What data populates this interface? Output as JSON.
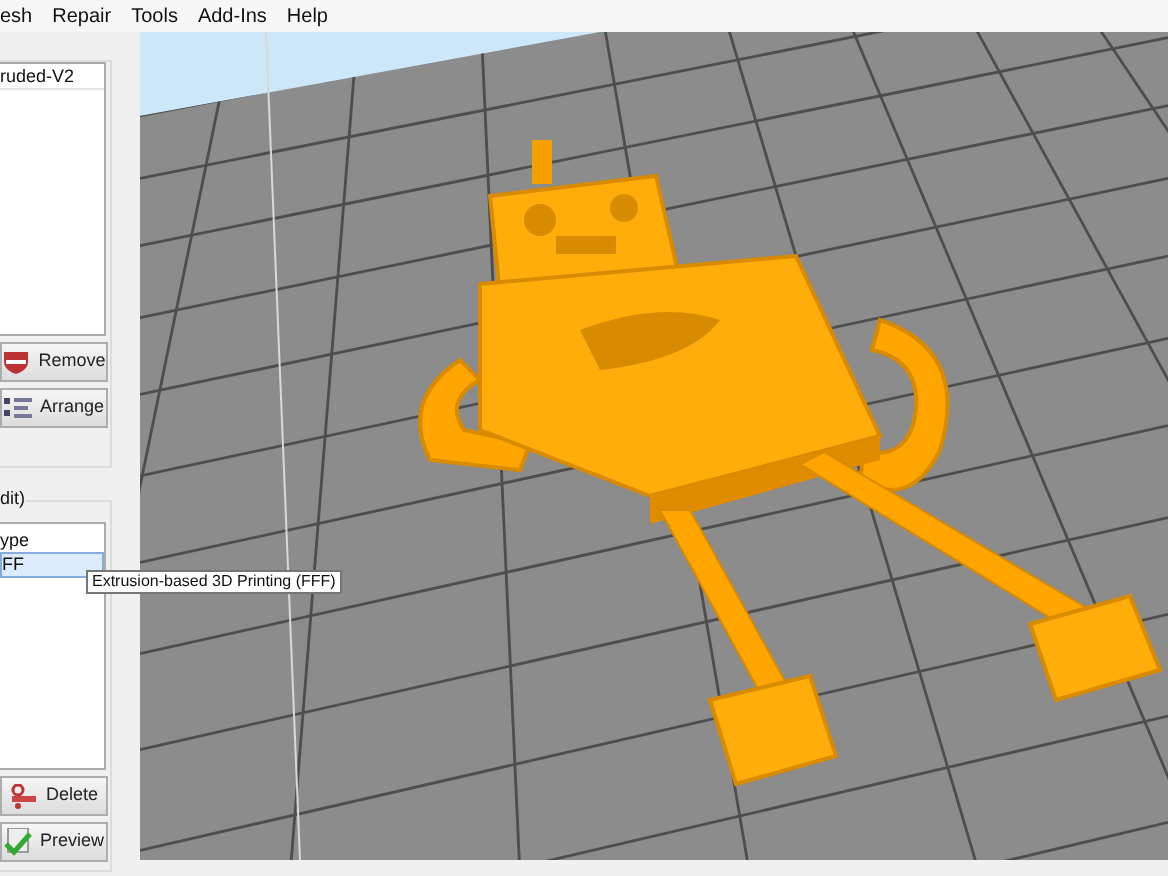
{
  "menu": [
    "esh",
    "Repair",
    "Tools",
    "Add-Ins",
    "Help"
  ],
  "objects_panel": {
    "items": [
      {
        "label": "ruded-V2",
        "selected": false
      }
    ],
    "buttons": [
      {
        "label": "Remove",
        "kind": "remove"
      },
      {
        "label": "Arrange",
        "kind": "arrange"
      }
    ]
  },
  "slicing_panel": {
    "title": "dit)",
    "header": "ype",
    "items": [
      {
        "label": "FF",
        "selected": true
      }
    ],
    "tooltip": "Extrusion-based 3D Printing (FFF)",
    "buttons": [
      {
        "label": "Delete",
        "kind": "delete"
      },
      {
        "label": "Preview",
        "kind": "preview"
      }
    ]
  }
}
